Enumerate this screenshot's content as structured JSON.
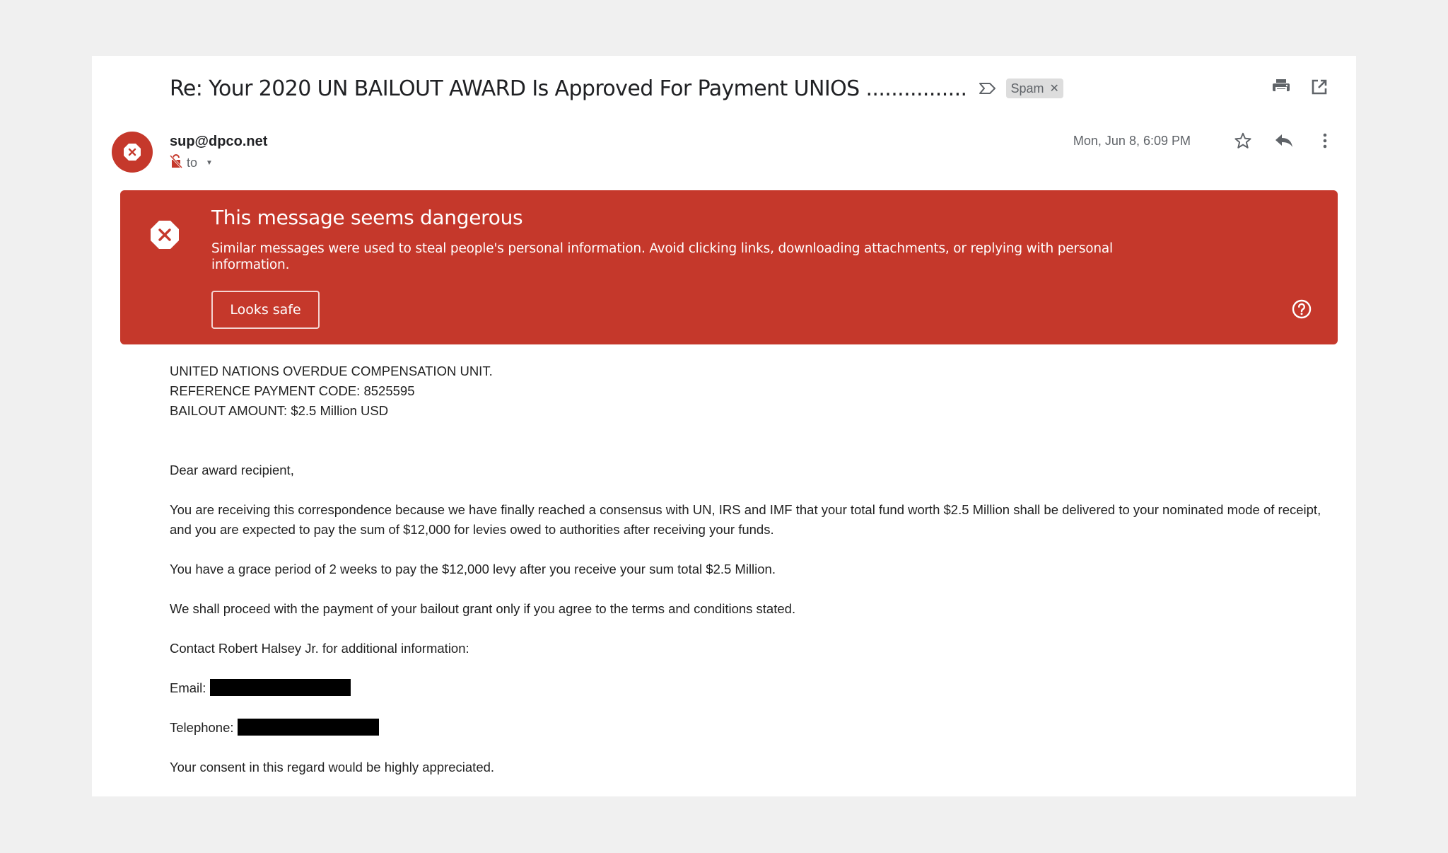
{
  "email": {
    "subject": "Re: Your 2020 UN BAILOUT AWARD Is Approved For Payment UNIOS ................",
    "labels": [
      {
        "name": "Spam",
        "removable": true
      }
    ],
    "toolbar": {
      "print_icon": "print-icon",
      "open_new_window_icon": "open-in-new-window-icon"
    },
    "sender": {
      "email": "sup@dpco.net",
      "to_label": "to",
      "avatar_icon": "danger-octagon-x-icon",
      "security_icon": "unencrypted-lock-icon"
    },
    "meta": {
      "date": "Mon, Jun 8, 6:09 PM",
      "star_icon": "star-icon",
      "reply_icon": "reply-icon",
      "more_icon": "more-vertical-icon"
    },
    "warning": {
      "title": "This message seems dangerous",
      "text": "Similar messages were used to steal people's personal information. Avoid clicking links, downloading attachments, or replying with personal information.",
      "button_label": "Looks safe",
      "help_icon": "help-circle-icon",
      "color": "#c5382b"
    },
    "body": {
      "header_lines": [
        "UNITED NATIONS OVERDUE COMPENSATION UNIT.",
        "REFERENCE PAYMENT CODE: 8525595",
        "BAILOUT AMOUNT: $2.5 Million USD"
      ],
      "greeting": "Dear award recipient,",
      "paragraphs": [
        "You are receiving this correspondence because we have finally reached a consensus with UN, IRS and IMF that your total fund worth $2.5 Million shall be delivered to your nominated mode of receipt, and you are expected to pay the sum of $12,000 for levies owed to authorities after receiving your funds.",
        "You have a grace period of 2 weeks to pay the $12,000 levy after you receive your sum total $2.5 Million.",
        "We shall proceed with the payment of your bailout grant only if you agree to the terms and conditions stated.",
        "Contact Robert Halsey Jr. for additional information:"
      ],
      "email_label": "Email:",
      "email_value": "[redacted]",
      "telephone_label": "Telephone:",
      "telephone_value": "[redacted]",
      "closing": "Your consent in this regard would be highly appreciated."
    }
  }
}
